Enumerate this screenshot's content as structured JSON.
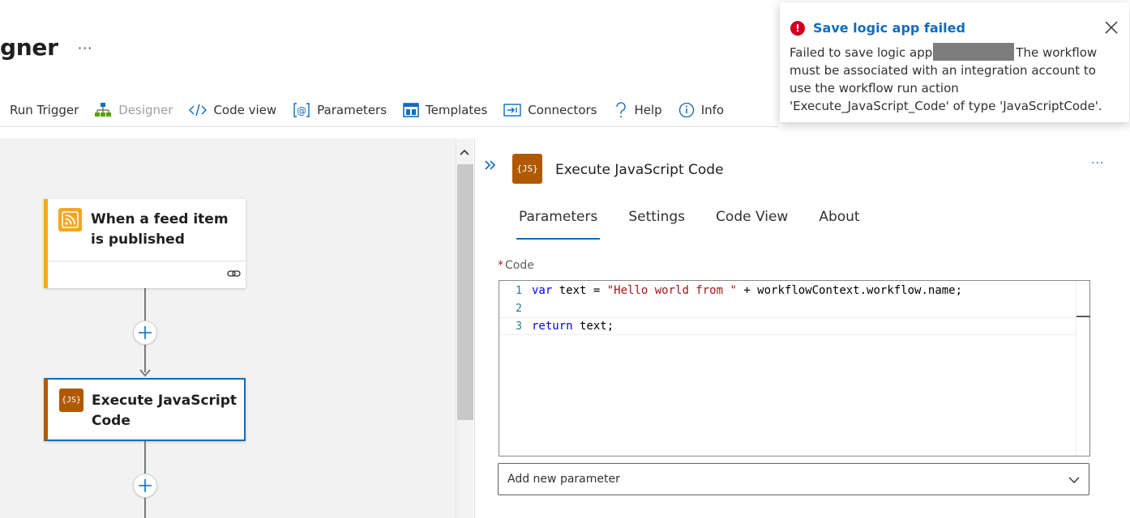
{
  "header": {
    "title": "gner",
    "more_label": "···"
  },
  "toolbar": {
    "items": [
      {
        "label": "Run Trigger",
        "icon": "none"
      },
      {
        "label": "Designer",
        "icon": "designer-icon",
        "disabled": true
      },
      {
        "label": "Code view",
        "icon": "code-icon"
      },
      {
        "label": "Parameters",
        "icon": "parameters-icon"
      },
      {
        "label": "Templates",
        "icon": "templates-icon"
      },
      {
        "label": "Connectors",
        "icon": "connectors-icon"
      },
      {
        "label": "Help",
        "icon": "help-icon"
      },
      {
        "label": "Info",
        "icon": "info-icon"
      }
    ]
  },
  "canvas": {
    "trigger": {
      "title": "When a feed item is published",
      "icon": "rss-icon",
      "accent": "#f5a623"
    },
    "action": {
      "title": "Execute JavaScript Code",
      "icon_text": "{JS}",
      "accent": "#b05a00",
      "selected": true
    }
  },
  "panel": {
    "title": "Execute JavaScript Code",
    "icon_text": "{JS}",
    "more_label": "···",
    "tabs": [
      "Parameters",
      "Settings",
      "Code View",
      "About"
    ],
    "active_tab": "Parameters",
    "code_label": "Code",
    "required_mark": "*",
    "code_lines": [
      {
        "num": "1",
        "kw": "var",
        "rest_a": " text = ",
        "str": "\"Hello world from \"",
        "rest_b": " + workflowContext.workflow.name;"
      },
      {
        "num": "2"
      },
      {
        "num": "3",
        "kw": "return",
        "rest_a": " text;"
      }
    ],
    "add_parameter_label": "Add new parameter"
  },
  "toast": {
    "title": "Save logic app failed",
    "body_prefix": "Failed to save logic app",
    "body_suffix": "The workflow must be associated with an integration account to use the workflow run action 'Execute_JavaScript_Code' of type 'JavaScriptCode'.",
    "status_color": "#d0021b",
    "title_color": "#0f6cbd"
  }
}
